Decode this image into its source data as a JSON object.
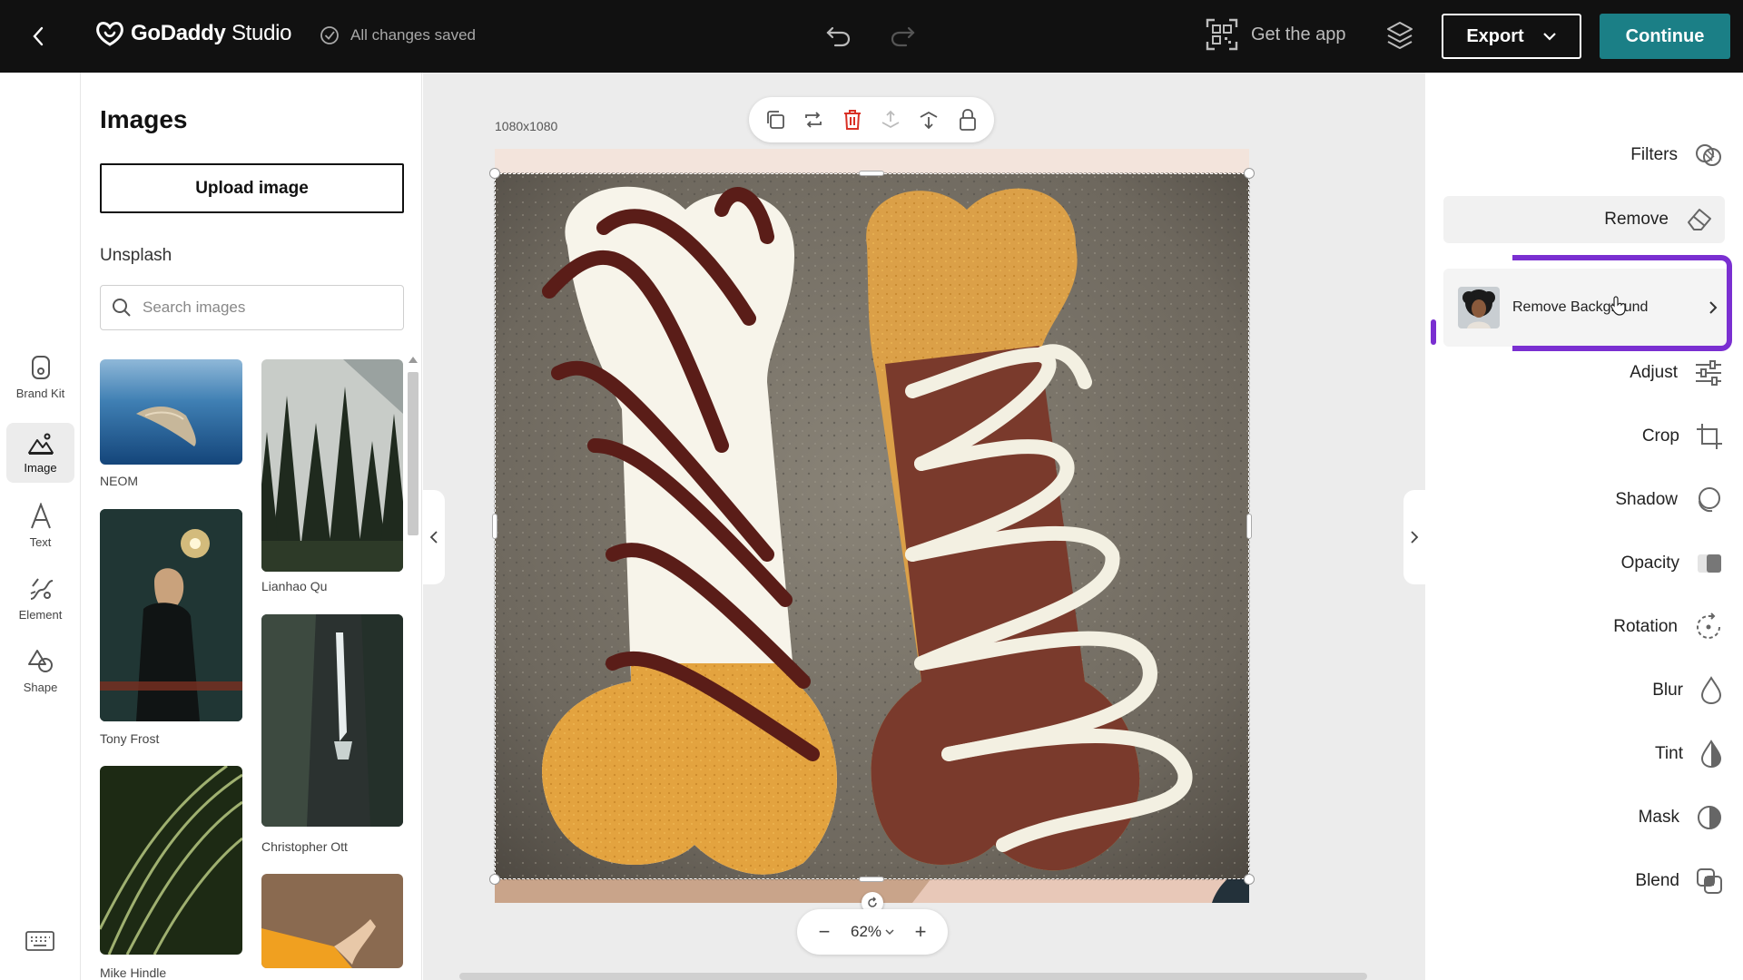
{
  "topbar": {
    "logo_bold": "GoDaddy",
    "logo_light": " Studio",
    "saved_status": "All changes saved",
    "get_app": "Get the app",
    "export": "Export",
    "continue": "Continue"
  },
  "rail": {
    "items": [
      {
        "label": "Brand Kit",
        "icon": "brand-kit-icon"
      },
      {
        "label": "Image",
        "icon": "image-icon",
        "active": true
      },
      {
        "label": "Text",
        "icon": "text-icon"
      },
      {
        "label": "Element",
        "icon": "element-icon"
      },
      {
        "label": "Shape",
        "icon": "shape-icon"
      }
    ]
  },
  "panel": {
    "title": "Images",
    "upload": "Upload image",
    "section": "Unsplash",
    "search_placeholder": "Search images",
    "thumbs": [
      {
        "caption": "NEOM"
      },
      {
        "caption": "Lianhao Qu"
      },
      {
        "caption": "Tony Frost"
      },
      {
        "caption": "Christopher Ott"
      },
      {
        "caption": "Mike Hindle"
      },
      {
        "caption": ""
      }
    ]
  },
  "canvas": {
    "size_label": "1080x1080",
    "zoom": "62%"
  },
  "right_panel": {
    "items": [
      {
        "label": "Filters",
        "icon": "filters-icon"
      },
      {
        "label": "Remove",
        "icon": "eraser-icon"
      },
      {
        "label": "Adjust",
        "icon": "sliders-icon"
      },
      {
        "label": "Crop",
        "icon": "crop-icon"
      },
      {
        "label": "Shadow",
        "icon": "shadow-icon"
      },
      {
        "label": "Opacity",
        "icon": "opacity-icon"
      },
      {
        "label": "Rotation",
        "icon": "rotation-icon"
      },
      {
        "label": "Blur",
        "icon": "blur-drop-icon"
      },
      {
        "label": "Tint",
        "icon": "tint-drop-icon"
      },
      {
        "label": "Mask",
        "icon": "mask-icon"
      },
      {
        "label": "Blend",
        "icon": "blend-icon"
      }
    ],
    "remove_background": "Remove Background"
  },
  "colors": {
    "topbar_bg": "#111111",
    "continue_bg": "#1b7f86",
    "highlight": "#7a2fd1",
    "canvas_bg": "#ececec"
  }
}
